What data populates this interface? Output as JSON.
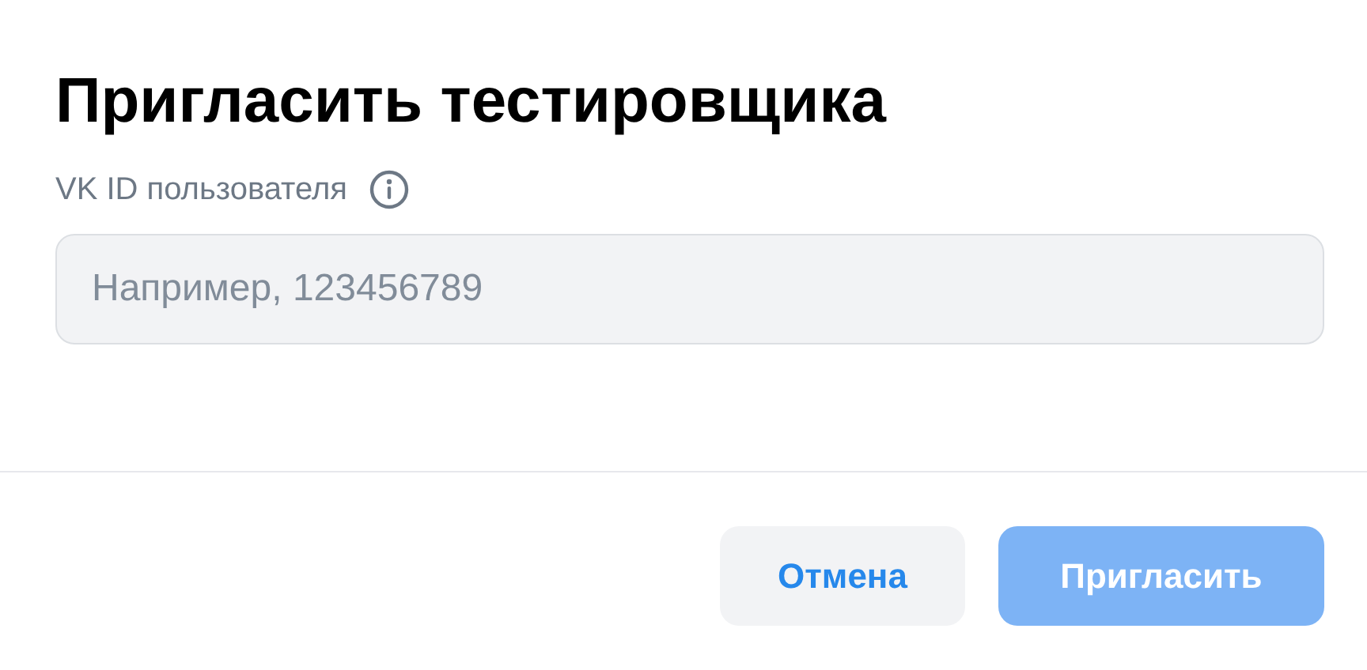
{
  "title": "Пригласить тестировщика",
  "field": {
    "label": "VK ID пользователя",
    "placeholder": "Например, 123456789"
  },
  "buttons": [
    {
      "label": "Отмена",
      "kind": "secondary",
      "disabled": false
    },
    {
      "label": "Пригласить",
      "kind": "primary",
      "disabled": true
    }
  ]
}
